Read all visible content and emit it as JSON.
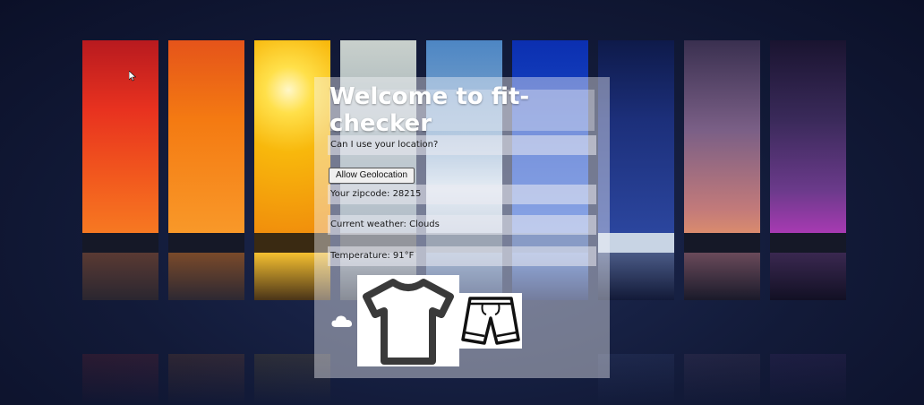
{
  "app": {
    "title": "Welcome to fit-checker"
  },
  "prompts": {
    "location_question": "Can I use your location?",
    "allow_button": "Allow Geolocation"
  },
  "info": {
    "zipcode_text": "Your zipcode: 28215",
    "weather_text": "Current weather: Clouds",
    "temperature_text": "Temperature: 91°F"
  },
  "icons": {
    "weather": "cloud-icon",
    "top": "t-shirt-icon",
    "bottom": "shorts-icon"
  },
  "colors": {
    "strip_skies": [
      "#e8321f",
      "#f47a12",
      "#f8b80c",
      "#9fb0b6",
      "#7fa6cc",
      "#1846c4",
      "#1c2f7a",
      "#7a5f86",
      "#3a2a5a"
    ]
  }
}
